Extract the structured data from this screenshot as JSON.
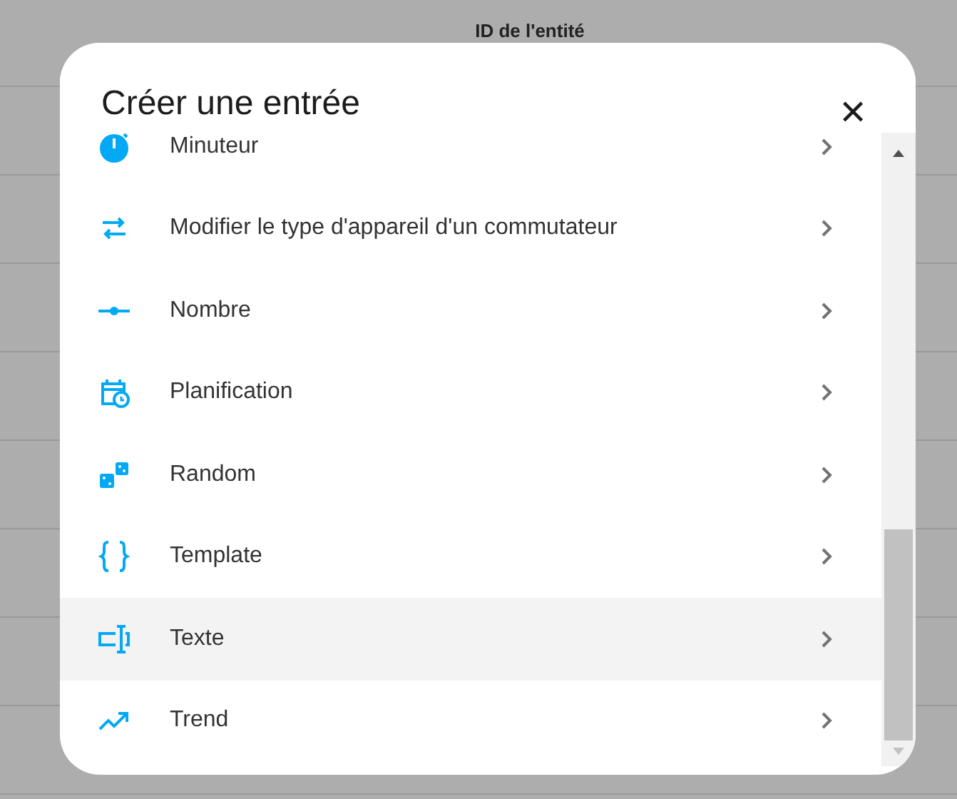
{
  "background_table": {
    "column_header": "ID de l'entité"
  },
  "dialog": {
    "title": "Créer une entrée",
    "close_label": "✕",
    "items": [
      {
        "label": "Minuteur",
        "selected": false
      },
      {
        "label": "Modifier le type d'appareil d'un commutateur",
        "selected": false
      },
      {
        "label": "Nombre",
        "selected": false
      },
      {
        "label": "Planification",
        "selected": false
      },
      {
        "label": "Random",
        "selected": false
      },
      {
        "label": "Template",
        "selected": false
      },
      {
        "label": "Texte",
        "selected": true
      },
      {
        "label": "Trend",
        "selected": false
      }
    ]
  }
}
